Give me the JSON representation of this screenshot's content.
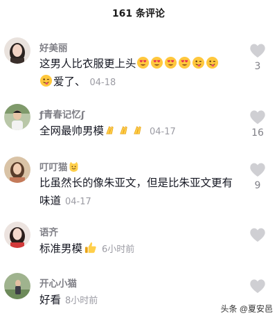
{
  "header": {
    "title": "161 条评论"
  },
  "comments": [
    {
      "username": "好美丽",
      "text": "这男人比衣服更上头",
      "text2": "爱了、",
      "date": "04-18",
      "likes": "3"
    },
    {
      "username": "ƒ青春记忆ʃ",
      "text": "全网最帅男模",
      "date": "04-17",
      "likes": "16"
    },
    {
      "username": "叮叮猫",
      "text": "比虽然长的像朱亚文，但是比朱亚文更有味道",
      "date": "04-17",
      "likes": "9"
    },
    {
      "username": "语齐",
      "text": "标准男模",
      "date": "6小时前",
      "likes": ""
    },
    {
      "username": "开心小猫",
      "text": "好看",
      "date": "8小时前",
      "likes": ""
    }
  ],
  "watermark": "头条 @夏安邑",
  "icons": {
    "like": "heart-icon",
    "emoji_heart_eyes": "heart-eyes-emoji",
    "emoji_wink": "wink-tongue-emoji",
    "emoji_clap": "clap-emoji",
    "emoji_thumbs": "thumbs-up-emoji",
    "emoji_cat": "cat-emoji"
  },
  "colors": {
    "like_icon": "#cfcfd3",
    "username": "#7f7f86",
    "date": "#9b9ba3"
  }
}
